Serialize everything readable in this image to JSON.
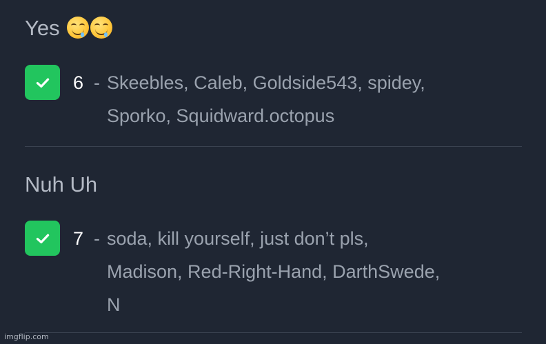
{
  "sections": [
    {
      "title": "Yes",
      "emoji": [
        "drooling-face",
        "drooling-face"
      ],
      "checked": true,
      "count": "6",
      "separator": "-",
      "voters_line1": "Skeebles, Caleb, Goldside543, spidey,",
      "voters_line2": "Sporko, Squidward.octopus",
      "voters_line3": ""
    },
    {
      "title": "Nuh Uh",
      "emoji": [],
      "checked": true,
      "count": "7",
      "separator": "-",
      "voters_line1": "soda, kill yourself, just don’t pls,",
      "voters_line2": "Madison, Red-Right-Hand, DarthSwede,",
      "voters_line3": "N"
    }
  ],
  "watermark": "imgflip.com",
  "colors": {
    "background": "#1f2633",
    "check": "#22c55e",
    "text_muted": "#9aa2ae",
    "title": "#b4bac5"
  }
}
